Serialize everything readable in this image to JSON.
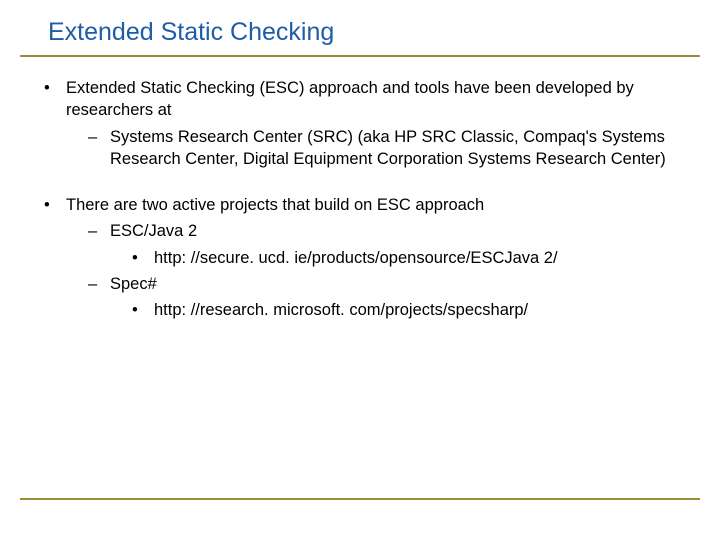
{
  "title": "Extended Static Checking",
  "bullets": {
    "b1": "Extended Static Checking (ESC) approach and tools have been developed by researchers at",
    "b1_1": "Systems Research Center (SRC) (aka HP SRC Classic, Compaq's Systems Research Center, Digital Equipment Corporation Systems Research Center)",
    "b2": "There are two active projects that build on ESC approach",
    "b2_1": "ESC/Java 2",
    "b2_1_1": "http: //secure. ucd. ie/products/opensource/ESCJava 2/",
    "b2_2": "Spec#",
    "b2_2_1": "http: //research. microsoft. com/projects/specsharp/"
  },
  "markers": {
    "l1": "•",
    "l2": "–",
    "l3": "•"
  },
  "colors": {
    "title": "#1f5da8",
    "rule": "#9e8a3a"
  }
}
